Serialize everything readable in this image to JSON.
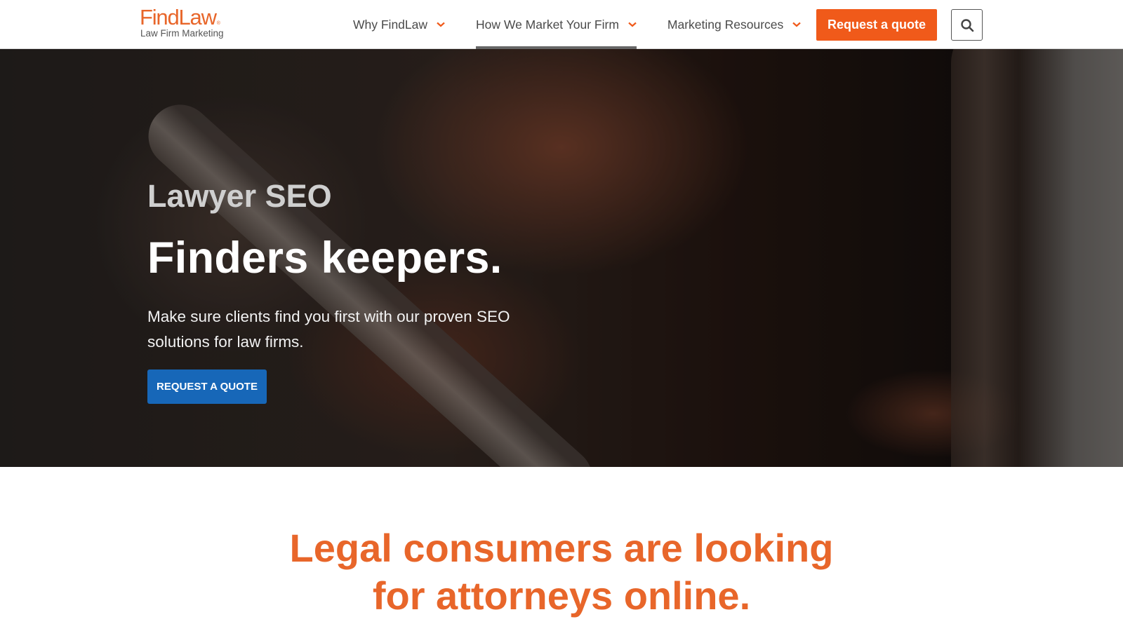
{
  "logo": {
    "word": "FindLaw",
    "reg": "®",
    "sub": "Law Firm Marketing"
  },
  "nav": {
    "items": [
      {
        "label": "Why FindLaw"
      },
      {
        "label": "How We Market Your Firm"
      },
      {
        "label": "Marketing Resources"
      }
    ],
    "quote_button": "Request a quote"
  },
  "hero": {
    "eyebrow": "Lawyer SEO",
    "title": "Finders keepers.",
    "description": "Make sure clients find you first with our proven SEO solutions for law firms.",
    "cta": "REQUEST A QUOTE"
  },
  "section": {
    "headline_line1": "Legal consumers are looking",
    "headline_line2": "for attorneys online."
  },
  "icons": {
    "search": "search-icon",
    "chevron": "chevron-down-icon"
  },
  "colors": {
    "brand_orange": "#f05a1a",
    "cta_blue": "#1767b8"
  }
}
